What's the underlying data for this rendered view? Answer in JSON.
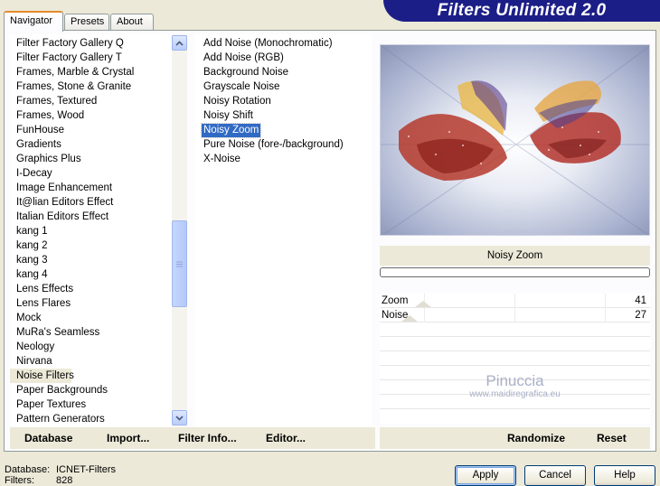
{
  "tabs": [
    {
      "label": "Navigator",
      "active": true
    },
    {
      "label": "Presets",
      "active": false
    },
    {
      "label": "About",
      "active": false
    }
  ],
  "banner": {
    "title": "Filters Unlimited 2.0"
  },
  "categories": [
    "Filter Factory Gallery Q",
    "Filter Factory Gallery T",
    "Frames, Marble & Crystal",
    "Frames, Stone & Granite",
    "Frames, Textured",
    "Frames, Wood",
    "FunHouse",
    "Gradients",
    "Graphics Plus",
    "I-Decay",
    "Image Enhancement",
    "It@lian Editors Effect",
    "Italian Editors Effect",
    "kang 1",
    "kang 2",
    "kang 3",
    "kang 4",
    "Lens Effects",
    "Lens Flares",
    "Mock",
    "MuRa's Seamless",
    "Neology",
    "Nirvana",
    "Noise Filters",
    "Paper Backgrounds",
    "Paper Textures",
    "Pattern Generators"
  ],
  "selected_category_index": 23,
  "filters": [
    "Add Noise (Monochromatic)",
    "Add Noise (RGB)",
    "Background Noise",
    "Grayscale Noise",
    "Noisy Rotation",
    "Noisy Shift",
    "Noisy Zoom",
    "Pure Noise (fore-/background)",
    "X-Noise"
  ],
  "selected_filter_index": 6,
  "preview": {
    "filter_name": "Noisy Zoom",
    "watermark_name": "Pinuccia",
    "watermark_url": "www.maidiregrafica.eu"
  },
  "params": [
    {
      "label": "Zoom",
      "value": "41",
      "fraction": 0.16
    },
    {
      "label": "Noise",
      "value": "27",
      "fraction": 0.11
    }
  ],
  "toolbar": {
    "database": "Database",
    "import": "Import...",
    "filter_info": "Filter Info...",
    "editor": "Editor...",
    "randomize": "Randomize",
    "reset": "Reset"
  },
  "status": {
    "database_label": "Database:",
    "database_value": "ICNET-Filters",
    "filters_label": "Filters:",
    "filters_value": "828"
  },
  "buttons": {
    "apply": "Apply",
    "cancel": "Cancel",
    "help": "Help"
  },
  "colors": {
    "banner": "#1c1e87",
    "selection": "#316ac5",
    "tab_highlight": "#e68b2c"
  }
}
